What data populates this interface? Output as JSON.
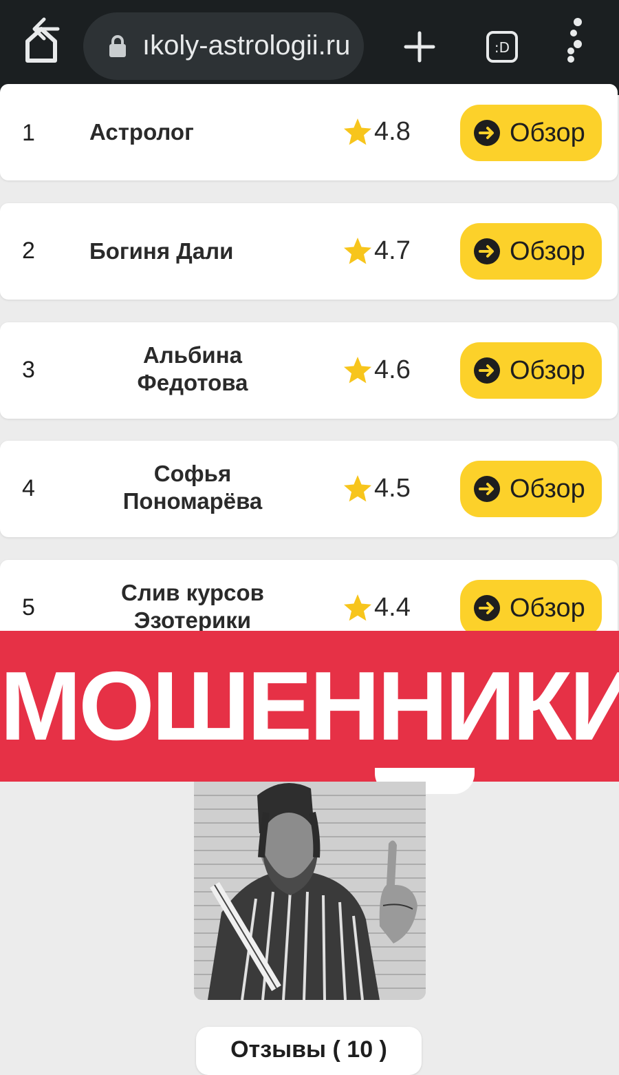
{
  "browser": {
    "url": "ıkoly-astrologii.ru",
    "tabs_label": ":D",
    "icons": [
      "back-home-icon",
      "lock-icon",
      "plus-icon",
      "tabs-icon",
      "menu-dots-icon"
    ]
  },
  "ratings": [
    {
      "rank": "1",
      "name": "Астролог",
      "score": "4.8",
      "button": "Обзор"
    },
    {
      "rank": "2",
      "name": "Богиня Дали",
      "score": "4.7",
      "button": "Обзор"
    },
    {
      "rank": "3",
      "name": "Альбина Федотова",
      "score": "4.6",
      "button": "Обзор"
    },
    {
      "rank": "4",
      "name": "Софья Пономарёва",
      "score": "4.5",
      "button": "Обзор"
    },
    {
      "rank": "5",
      "name": "Слив курсов Эзотерики",
      "score": "4.4",
      "button": "Обзор"
    }
  ],
  "banner": {
    "text": "МОШЕННИКИ",
    "color": "#e63146"
  },
  "reviews": {
    "label": "Отзывы ( 10 )"
  },
  "colors": {
    "accent": "#fcd12a",
    "topbar": "#1b1f21",
    "star": "#f7c51c"
  }
}
